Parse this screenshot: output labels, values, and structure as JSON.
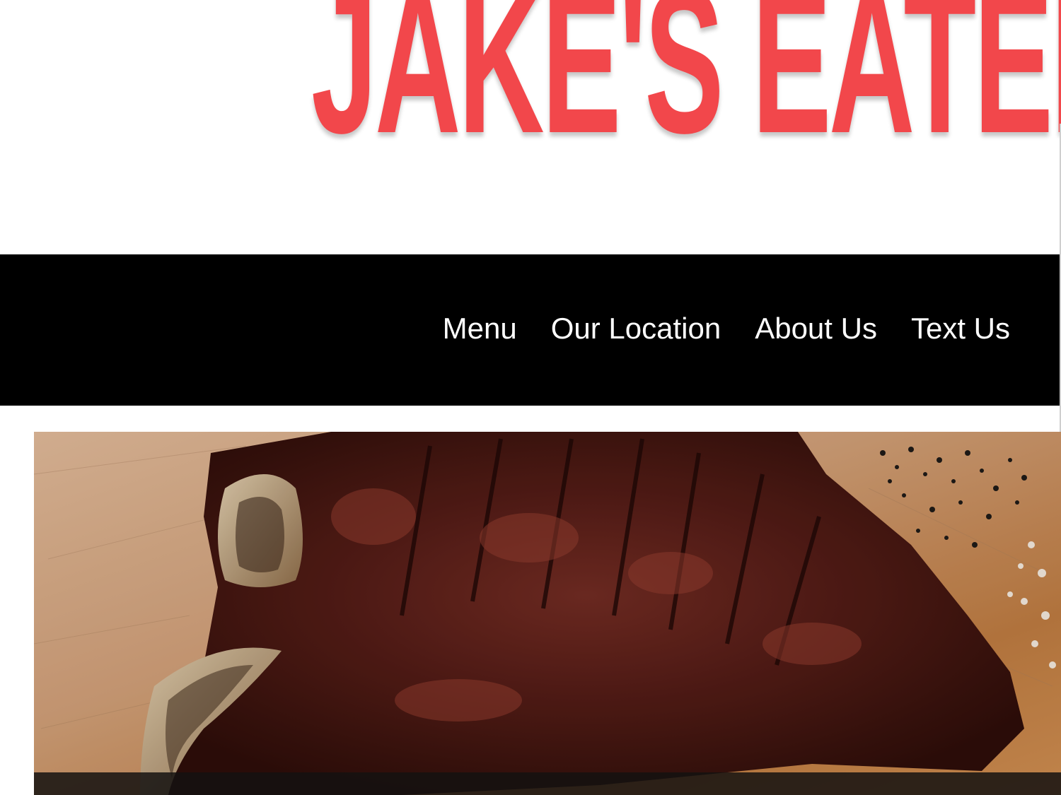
{
  "site": {
    "logo_text": "JAKE'S EATERY",
    "brand_color": "#f2474b"
  },
  "nav": {
    "background": "#000000",
    "items": [
      {
        "label": "Menu"
      },
      {
        "label": "Our Location"
      },
      {
        "label": "About Us"
      },
      {
        "label": "Text Us"
      }
    ]
  },
  "hero": {
    "image_subject": "sliced grilled t-bone steak on a wooden board with cracked pepper and salt"
  }
}
